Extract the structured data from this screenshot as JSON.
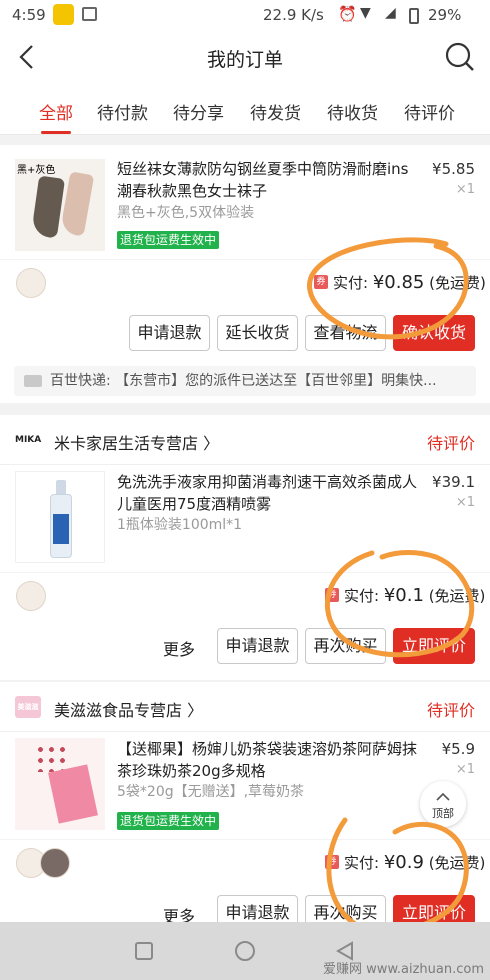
{
  "status_bar": {
    "time": "4:59",
    "network_speed": "22.9 K/s",
    "battery": "29%"
  },
  "header": {
    "title": "我的订单"
  },
  "tabs": [
    {
      "label": "全部",
      "active": true
    },
    {
      "label": "待付款"
    },
    {
      "label": "待分享"
    },
    {
      "label": "待发货"
    },
    {
      "label": "待收货"
    },
    {
      "label": "待评价"
    }
  ],
  "orders": [
    {
      "product": {
        "name": "短丝袜女薄款防勾钢丝夏季中筒防滑耐磨ins潮春秋款黑色女士袜子",
        "spec": "黑色+灰色,5双体验装",
        "price": "¥5.85",
        "qty": "×1",
        "badge": "退货包运费生效中",
        "thumb_label": "黑+灰色"
      },
      "payment": {
        "label": "实付: ",
        "amount": "¥0.85",
        "note": "(免运费)",
        "coupon": "券"
      },
      "buttons": {
        "refund": "申请退款",
        "extend": "延长收货",
        "logistics": "查看物流",
        "confirm": "确认收货"
      },
      "logistics": "百世快递: 【东营市】您的派件已送达至【百世邻里】明集快..."
    },
    {
      "shop": {
        "logo": "MIKA",
        "name": "米卡家居生活专营店 〉"
      },
      "status": "待评价",
      "product": {
        "name": "免洗洗手液家用抑菌消毒剂速干高效杀菌成人儿童医用75度酒精喷雾",
        "spec": "1瓶体验装100ml*1",
        "price": "¥39.1",
        "qty": "×1"
      },
      "payment": {
        "label": "实付: ",
        "amount": "¥0.1",
        "note": "(免运费)",
        "coupon": "券"
      },
      "buttons": {
        "more": "更多",
        "refund": "申请退款",
        "rebuy": "再次购买",
        "review": "立即评价"
      }
    },
    {
      "shop": {
        "logo": "美滋滋",
        "name": "美滋滋食品专营店 〉"
      },
      "status": "待评价",
      "product": {
        "name": "【送椰果】杨婶儿奶茶袋装速溶奶茶阿萨姆抹茶珍珠奶茶20g多规格",
        "spec": "5袋*20g【无赠送】,草莓奶茶",
        "price": "¥5.9",
        "qty": "×1",
        "badge": "退货包运费生效中"
      },
      "payment": {
        "label": "实付: ",
        "amount": "¥0.9",
        "note": "(免运费)",
        "coupon": "券"
      },
      "buttons": {
        "more": "更多",
        "refund": "申请退款",
        "rebuy": "再次购买",
        "review": "立即评价"
      }
    }
  ],
  "floating": {
    "top_label": "顶部"
  },
  "watermark": "爱赚网 www.aizhuan.com",
  "colors": {
    "accent": "#e02e24",
    "badge_green": "#21b24b",
    "annotation_orange": "#f39a3b"
  }
}
